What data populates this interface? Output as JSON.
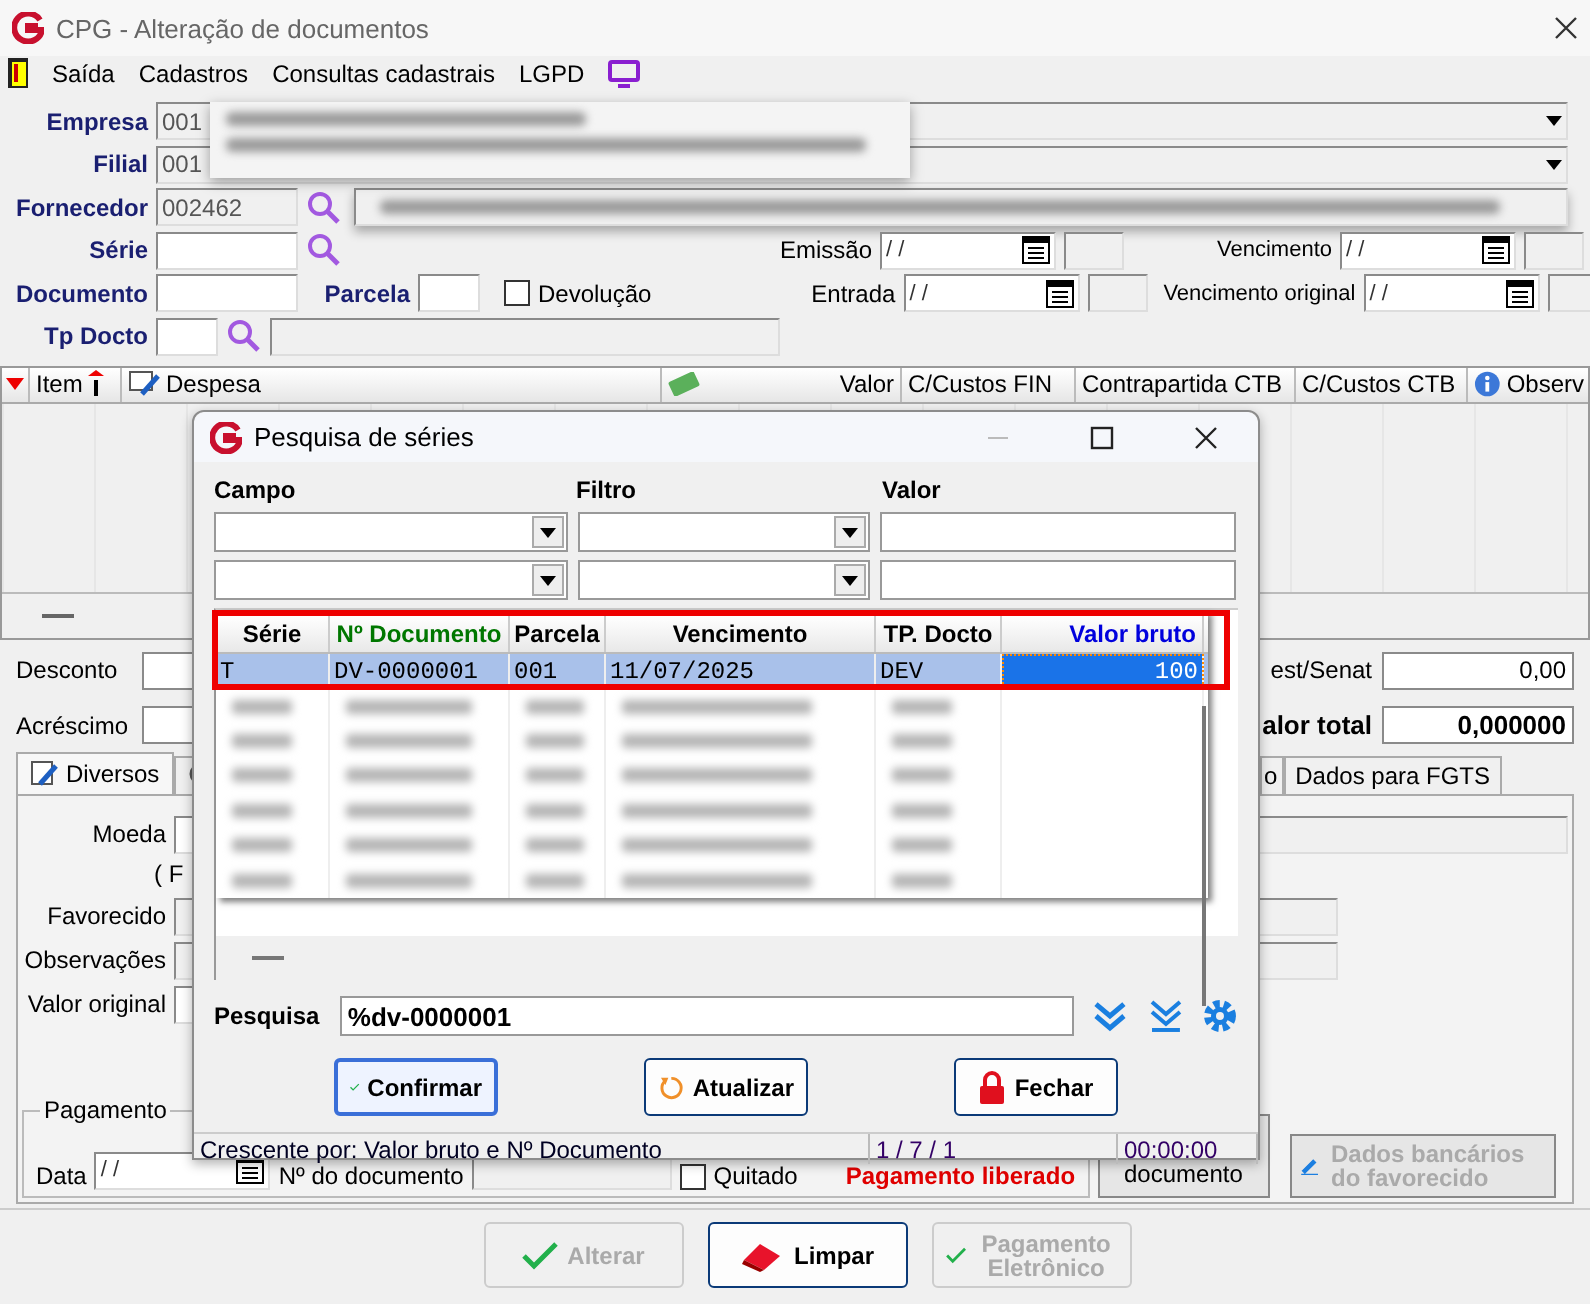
{
  "window": {
    "title": "CPG - Alteração de documentos"
  },
  "menu": [
    {
      "label": "Saída"
    },
    {
      "label": "Cadastros"
    },
    {
      "label": "Consultas cadastrais"
    },
    {
      "label": "LGPD"
    }
  ],
  "form": {
    "empresa": {
      "label": "Empresa",
      "value": "001"
    },
    "filial": {
      "label": "Filial",
      "value": "001"
    },
    "fornecedor": {
      "label": "Fornecedor",
      "value": "002462"
    },
    "serie": {
      "label": "Série"
    },
    "documento": {
      "label": "Documento"
    },
    "parcela": {
      "label": "Parcela"
    },
    "devolucao": {
      "label": "Devolução",
      "checked": false
    },
    "tp_docto": {
      "label": "Tp Docto"
    },
    "emissao": {
      "label": "Emissão",
      "value": "/ /"
    },
    "entrada": {
      "label": "Entrada",
      "value": "/ /"
    },
    "vencimento": {
      "label": "Vencimento",
      "value": "/ /"
    },
    "vencimento_original": {
      "label": "Vencimento original",
      "value": "/ /"
    }
  },
  "items_grid": {
    "columns": [
      {
        "label": "Item"
      },
      {
        "label": "Despesa"
      },
      {
        "label": "Valor"
      },
      {
        "label": "C/Custos FIN"
      },
      {
        "label": "Contrapartida CTB"
      },
      {
        "label": "C/Custos CTB"
      },
      {
        "label": "Observ"
      }
    ]
  },
  "totals": {
    "desconto": {
      "label": "Desconto"
    },
    "acrescimo": {
      "label": "Acréscimo"
    },
    "inss": {
      "label": "est/Senat",
      "value": "0,00"
    },
    "valor_total": {
      "label": "alor total",
      "value": "0,000000"
    }
  },
  "tabs": [
    {
      "label": "Diversos",
      "selected": true
    },
    {
      "selected": false
    },
    {
      "label": "o",
      "selected": false
    },
    {
      "label": "Dados para FGTS",
      "selected": false
    }
  ],
  "panel": {
    "moeda": {
      "label": "Moeda"
    },
    "note": "( F",
    "favorecido": {
      "label": "Favorecido"
    },
    "observacoes": {
      "label": "Observações"
    },
    "valor_original": {
      "label": "Valor original"
    },
    "pagamento": {
      "legend": "Pagamento",
      "data_label": "Data",
      "data_value": "/ /",
      "documento_label": "Nº do documento",
      "quitado": {
        "label": "Quitado",
        "checked": false
      },
      "liberado": "Pagamento liberado"
    },
    "documento_button": {
      "label": "documento"
    },
    "banco_button": {
      "label": "Dados bancários do favorecido",
      "disabled": true
    }
  },
  "buttons": [
    {
      "label": "Alterar",
      "disabled": true
    },
    {
      "label": "Limpar",
      "disabled": false
    },
    {
      "label": "Pagamento Eletrônico",
      "disabled": true
    }
  ],
  "dialog": {
    "title": "Pesquisa de séries",
    "filter_headers": [
      "Campo",
      "Filtro",
      "Valor"
    ],
    "series_grid": {
      "highlighted": true,
      "columns": [
        {
          "label": "Série",
          "color": "#000000"
        },
        {
          "label": "Nº Documento",
          "color": "#007700"
        },
        {
          "label": "Parcela",
          "color": "#000000"
        },
        {
          "label": "Vencimento",
          "color": "#000000"
        },
        {
          "label": "TP. Docto",
          "color": "#000000"
        },
        {
          "label": "Valor bruto",
          "color": "#0000dd"
        }
      ],
      "rows": [
        {
          "selected": true,
          "redacted": false,
          "cells": [
            {
              "text": "T",
              "focused": false
            },
            {
              "text": "DV-0000001",
              "focused": false
            },
            {
              "text": "001",
              "focused": false
            },
            {
              "text": "11/07/2025",
              "focused": false
            },
            {
              "text": "DEV",
              "focused": false
            },
            {
              "text": "100",
              "focused": true
            }
          ]
        },
        {
          "selected": false,
          "redacted": true
        },
        {
          "selected": false,
          "redacted": true
        },
        {
          "selected": false,
          "redacted": true
        },
        {
          "selected": false,
          "redacted": true
        },
        {
          "selected": false,
          "redacted": true
        },
        {
          "selected": false,
          "redacted": true
        }
      ]
    },
    "search": {
      "label": "Pesquisa",
      "value": "%dv-0000001"
    },
    "buttons": [
      {
        "kind": "confirm",
        "label": "Confirmar"
      },
      {
        "kind": "refresh",
        "label": "Atualizar"
      },
      {
        "kind": "close",
        "label": "Fechar"
      }
    ],
    "status": [
      "Crescente por: Valor bruto e Nº Documento",
      "1 / 7 / 1",
      "00:00:00"
    ]
  }
}
